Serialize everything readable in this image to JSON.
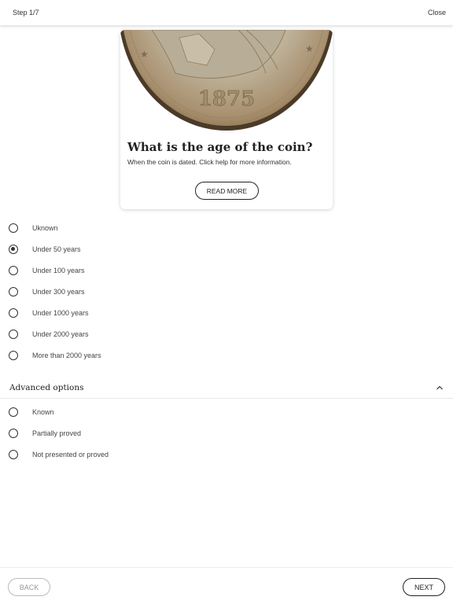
{
  "header": {
    "step": "Step 1/7",
    "close_label": "Close"
  },
  "card": {
    "image_icon": "coin-photo",
    "coin_year": "1875",
    "title": "What is the age of the coin?",
    "subtitle": "When the coin is dated. Click help for more information.",
    "read_more_label": "READ MORE"
  },
  "age_options": [
    {
      "label": "Uknown",
      "selected": false
    },
    {
      "label": "Under 50 years",
      "selected": true
    },
    {
      "label": "Under 100 years",
      "selected": false
    },
    {
      "label": "Under 300 years",
      "selected": false
    },
    {
      "label": "Under 1000 years",
      "selected": false
    },
    {
      "label": "Under 2000 years",
      "selected": false
    },
    {
      "label": "More than 2000 years",
      "selected": false
    }
  ],
  "advanced": {
    "title": "Advanced options",
    "expanded": true,
    "options": [
      {
        "label": "Known",
        "selected": false
      },
      {
        "label": "Partially proved",
        "selected": false
      },
      {
        "label": "Not presented or proved",
        "selected": false
      }
    ]
  },
  "footer": {
    "back_label": "BACK",
    "next_label": "NEXT",
    "back_enabled": false
  }
}
